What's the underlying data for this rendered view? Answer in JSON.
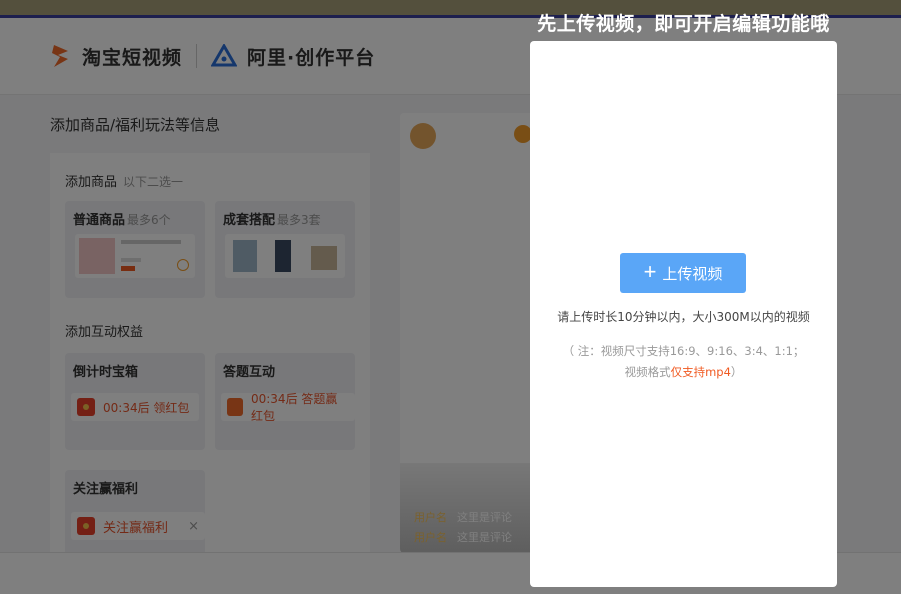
{
  "header": {
    "brand": "淘宝短视频",
    "platform": "阿里·创作平台"
  },
  "page": {
    "title": "添加商品/福利玩法等信息"
  },
  "goods_section": {
    "title": "添加商品",
    "hint": "以下二选一",
    "cards": [
      {
        "title": "普通商品",
        "sub": "最多6个"
      },
      {
        "title": "成套搭配",
        "sub": "最多3套"
      }
    ]
  },
  "benefit_section": {
    "title": "添加互动权益",
    "cards": [
      {
        "title": "倒计时宝箱",
        "text": "00:34后   领红包"
      },
      {
        "title": "答题互动",
        "text": "00:34后  答题赢红包"
      },
      {
        "title": "关注赢福利",
        "text": "关注赢福利",
        "close": "×"
      }
    ]
  },
  "preview": {
    "comments": [
      {
        "user": "用户名",
        "text": "这里是评论"
      },
      {
        "user": "用户名",
        "text": "这里是评论"
      }
    ]
  },
  "modal": {
    "title": "先上传视频，即可开启编辑功能哦",
    "upload_label": "上传视频",
    "plus": "+",
    "description": "请上传时长10分钟以内，大小300M以内的视频",
    "note_line1": "（ 注：视频尺寸支持16:9、9:16、3:4、1:1；",
    "note_line2_prefix": "视频格式",
    "note_line2_highlight": "仅支持mp4",
    "note_line2_suffix": "）"
  },
  "colors": {
    "accent_blue": "#5aa6f7",
    "highlight_orange": "#f05a22",
    "redpacket": "#e8402b"
  }
}
